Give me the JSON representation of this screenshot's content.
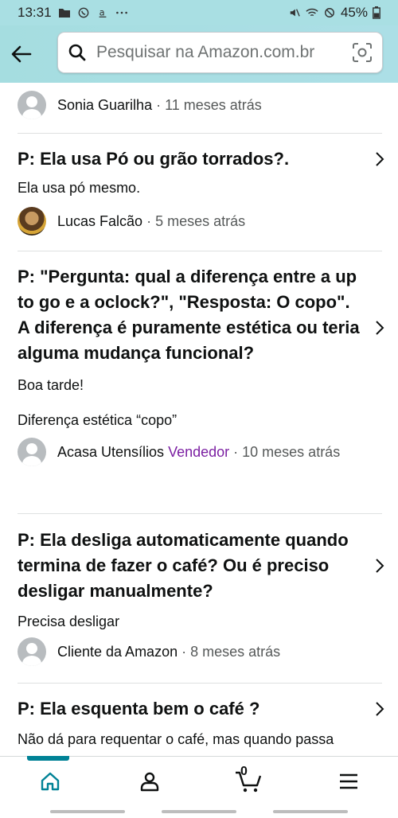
{
  "status": {
    "time": "13:31",
    "battery": "45%",
    "left_icons": [
      "folder-icon",
      "whatsapp-icon",
      "amazon-a-icon",
      "more-dots-icon"
    ],
    "right_icons": [
      "mute-icon",
      "wifi-icon",
      "dnd-icon",
      "battery-icon"
    ]
  },
  "header": {
    "search_placeholder": "Pesquisar na Amazon.com.br"
  },
  "top_partial": {
    "author": "Sonia Guarilha",
    "time": "11 meses atrás"
  },
  "questions": [
    {
      "question": "P: Ela usa Pó ou grão torrados?.",
      "answers": [
        "Ela usa pó mesmo."
      ],
      "author": "Lucas Falcão",
      "badge": "",
      "time": "5 meses atrás"
    },
    {
      "question": "P: \"Pergunta: qual a diferença entre a up to go e a oclock?\", \"Resposta: O copo\". A diferença é puramente estética ou teria alguma mudança funcional?",
      "answers": [
        "Boa tarde!",
        "Diferença estética “copo”"
      ],
      "author": "Acasa Utensílios",
      "badge": "Vendedor",
      "time": "10 meses atrás"
    },
    {
      "question": "P: Ela desliga automaticamente quando termina de fazer o café? Ou é preciso desligar manualmente?",
      "answers": [
        "Precisa desligar"
      ],
      "author": "Cliente da Amazon",
      "badge": "",
      "time": "8 meses atrás"
    },
    {
      "question": "P: Ela esquenta bem o café ?",
      "answers": [
        "Não dá para requentar o café, mas quando passa"
      ],
      "author": "",
      "badge": "",
      "time": ""
    }
  ],
  "bottom_nav": {
    "cart_count": "0",
    "items": [
      "home-icon",
      "account-icon",
      "cart-icon",
      "menu-icon"
    ]
  },
  "colors": {
    "header_bg": "#a9dfe3",
    "vendor": "#7b1fa2",
    "active_nav": "#008296"
  }
}
